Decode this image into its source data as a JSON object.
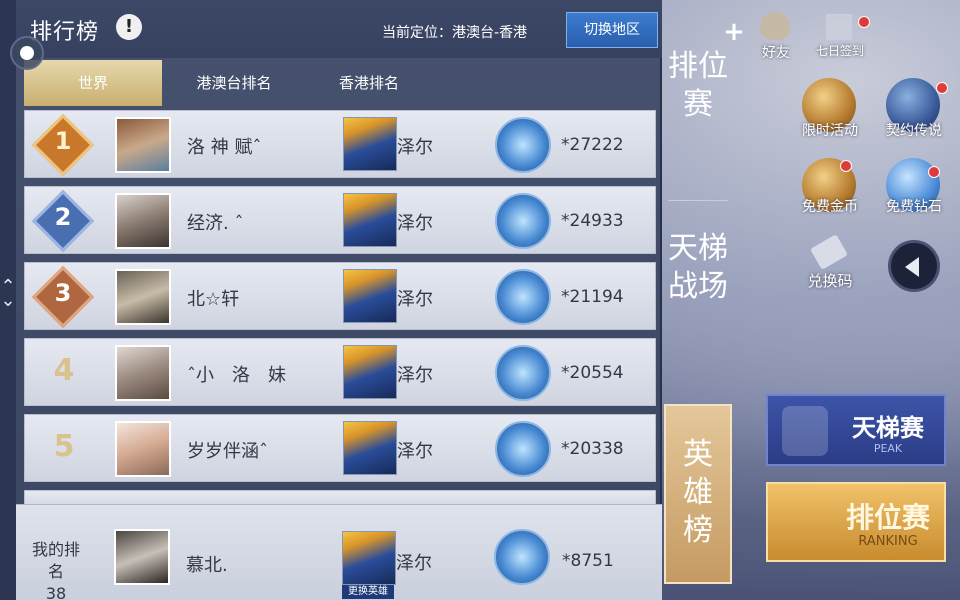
{
  "header": {
    "title": "排行榜",
    "info_icon": "exclamation-icon",
    "location_label": "当前定位：港澳台-香港",
    "switch_button": "切换地区"
  },
  "tabs": [
    {
      "label": "世界",
      "active": true
    },
    {
      "label": "港澳台排名",
      "active": false
    },
    {
      "label": "香港排名",
      "active": false
    }
  ],
  "rows": [
    {
      "rank": "1",
      "name": "洛 神 赋ˆ",
      "hero": "泽尔",
      "score": "*27222",
      "badge_color": "#c9782b"
    },
    {
      "rank": "2",
      "name": "经济. ˆ",
      "hero": "泽尔",
      "score": "*24933",
      "badge_color": "#4a6fb0"
    },
    {
      "rank": "3",
      "name": "北☆轩",
      "hero": "泽尔",
      "score": "*21194",
      "badge_color": "#b0673f"
    },
    {
      "rank": "4",
      "name": "ˆ小　洛　妹",
      "hero": "泽尔",
      "score": "*20554"
    },
    {
      "rank": "5",
      "name": "岁岁伴涵ˆ",
      "hero": "泽尔",
      "score": "*20338"
    }
  ],
  "my_rank": {
    "label": "我的排名",
    "rank": "38",
    "name": "慕北.",
    "hero": "泽尔",
    "score": "*8751",
    "change_hero": "更换英雄"
  },
  "vertical_tabs": [
    {
      "label": "排位赛",
      "active": false
    },
    {
      "label": "天梯战场",
      "active": false
    },
    {
      "label": "英雄榜",
      "active": true
    }
  ],
  "side_icons": {
    "friends": "好友",
    "checkin": "七日签到",
    "top_event": "限时活动",
    "legend": "契约传说",
    "gold": "免费金币",
    "diamond": "免费钻石",
    "redeem": "兑换码"
  },
  "mode_buttons": {
    "ladder_cn": "天梯赛",
    "ladder_en": "PEAK",
    "ranked_cn": "排位赛",
    "ranked_en": "RANKING"
  },
  "colors": {
    "accent_blue": "#2a5fae",
    "gold_tab": "#c9ae6f",
    "row_bg": "#dde1ea"
  }
}
